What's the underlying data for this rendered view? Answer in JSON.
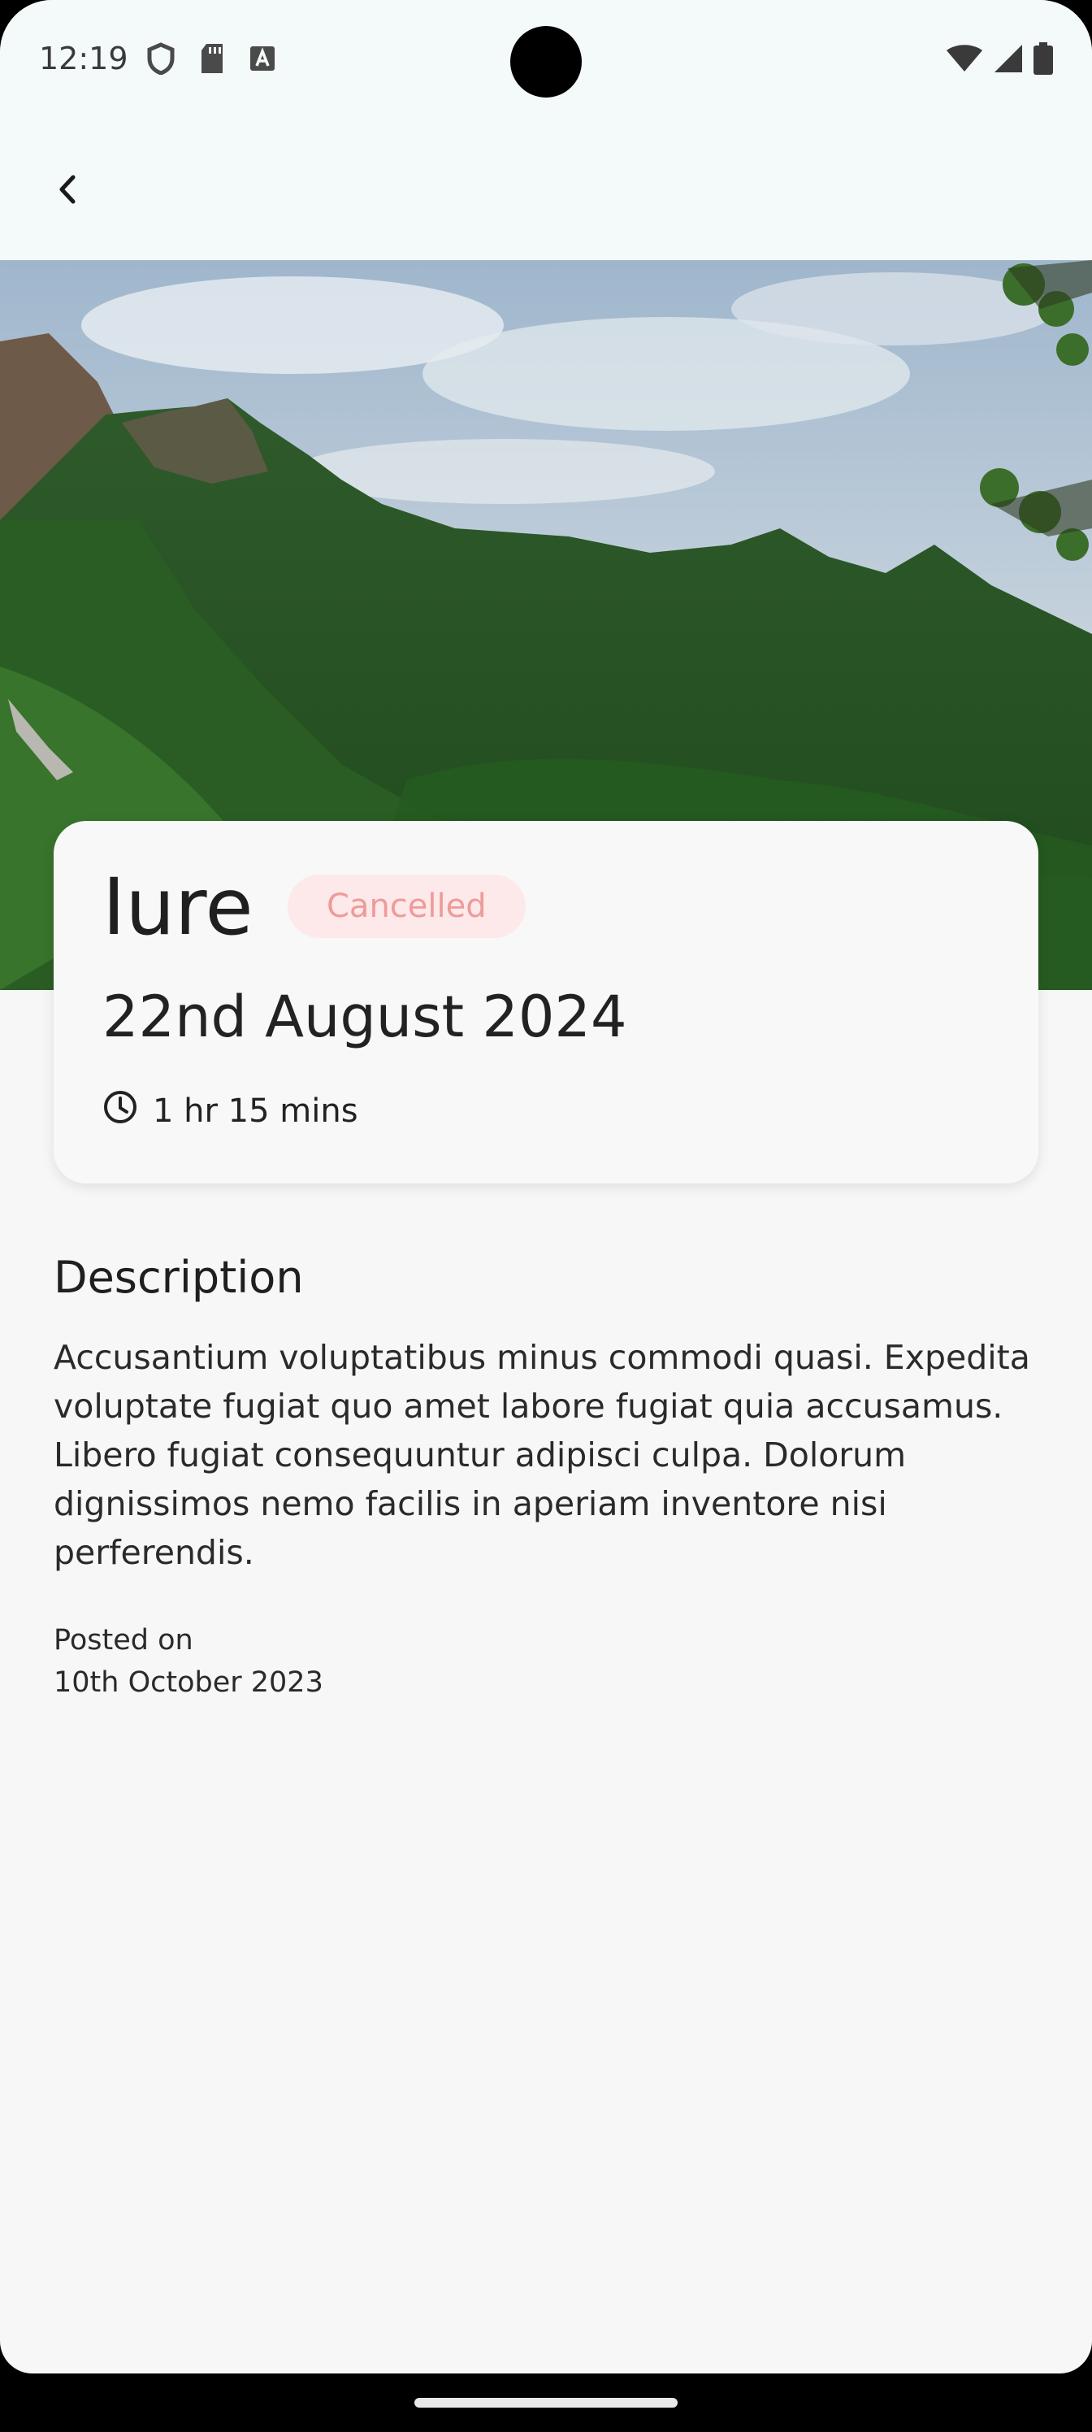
{
  "status_bar": {
    "time": "12:19",
    "left_icons": [
      "shield-icon",
      "sd-card-icon",
      "text-a-icon"
    ],
    "right_icons": [
      "wifi-icon",
      "signal-icon",
      "battery-icon"
    ]
  },
  "header": {
    "back_icon": "chevron-left-icon"
  },
  "hero": {
    "subject": "mountain landscape photo"
  },
  "card": {
    "title": "Iure",
    "status": "Cancelled",
    "status_color": "#ef9a9a",
    "status_bg": "#fde9e9",
    "date": "22nd August 2024",
    "duration": "1 hr 15 mins",
    "duration_icon": "clock-icon"
  },
  "description": {
    "heading": "Description",
    "text": "Accusantium voluptatibus minus commodi quasi. Expedita voluptate fugiat quo amet labore fugiat quia accusamus. Libero fugiat consequuntur adipisci culpa. Dolorum dignissimos nemo facilis in aperiam inventore nisi perferendis."
  },
  "posted": {
    "label": "Posted on",
    "date": "10th October 2023"
  }
}
